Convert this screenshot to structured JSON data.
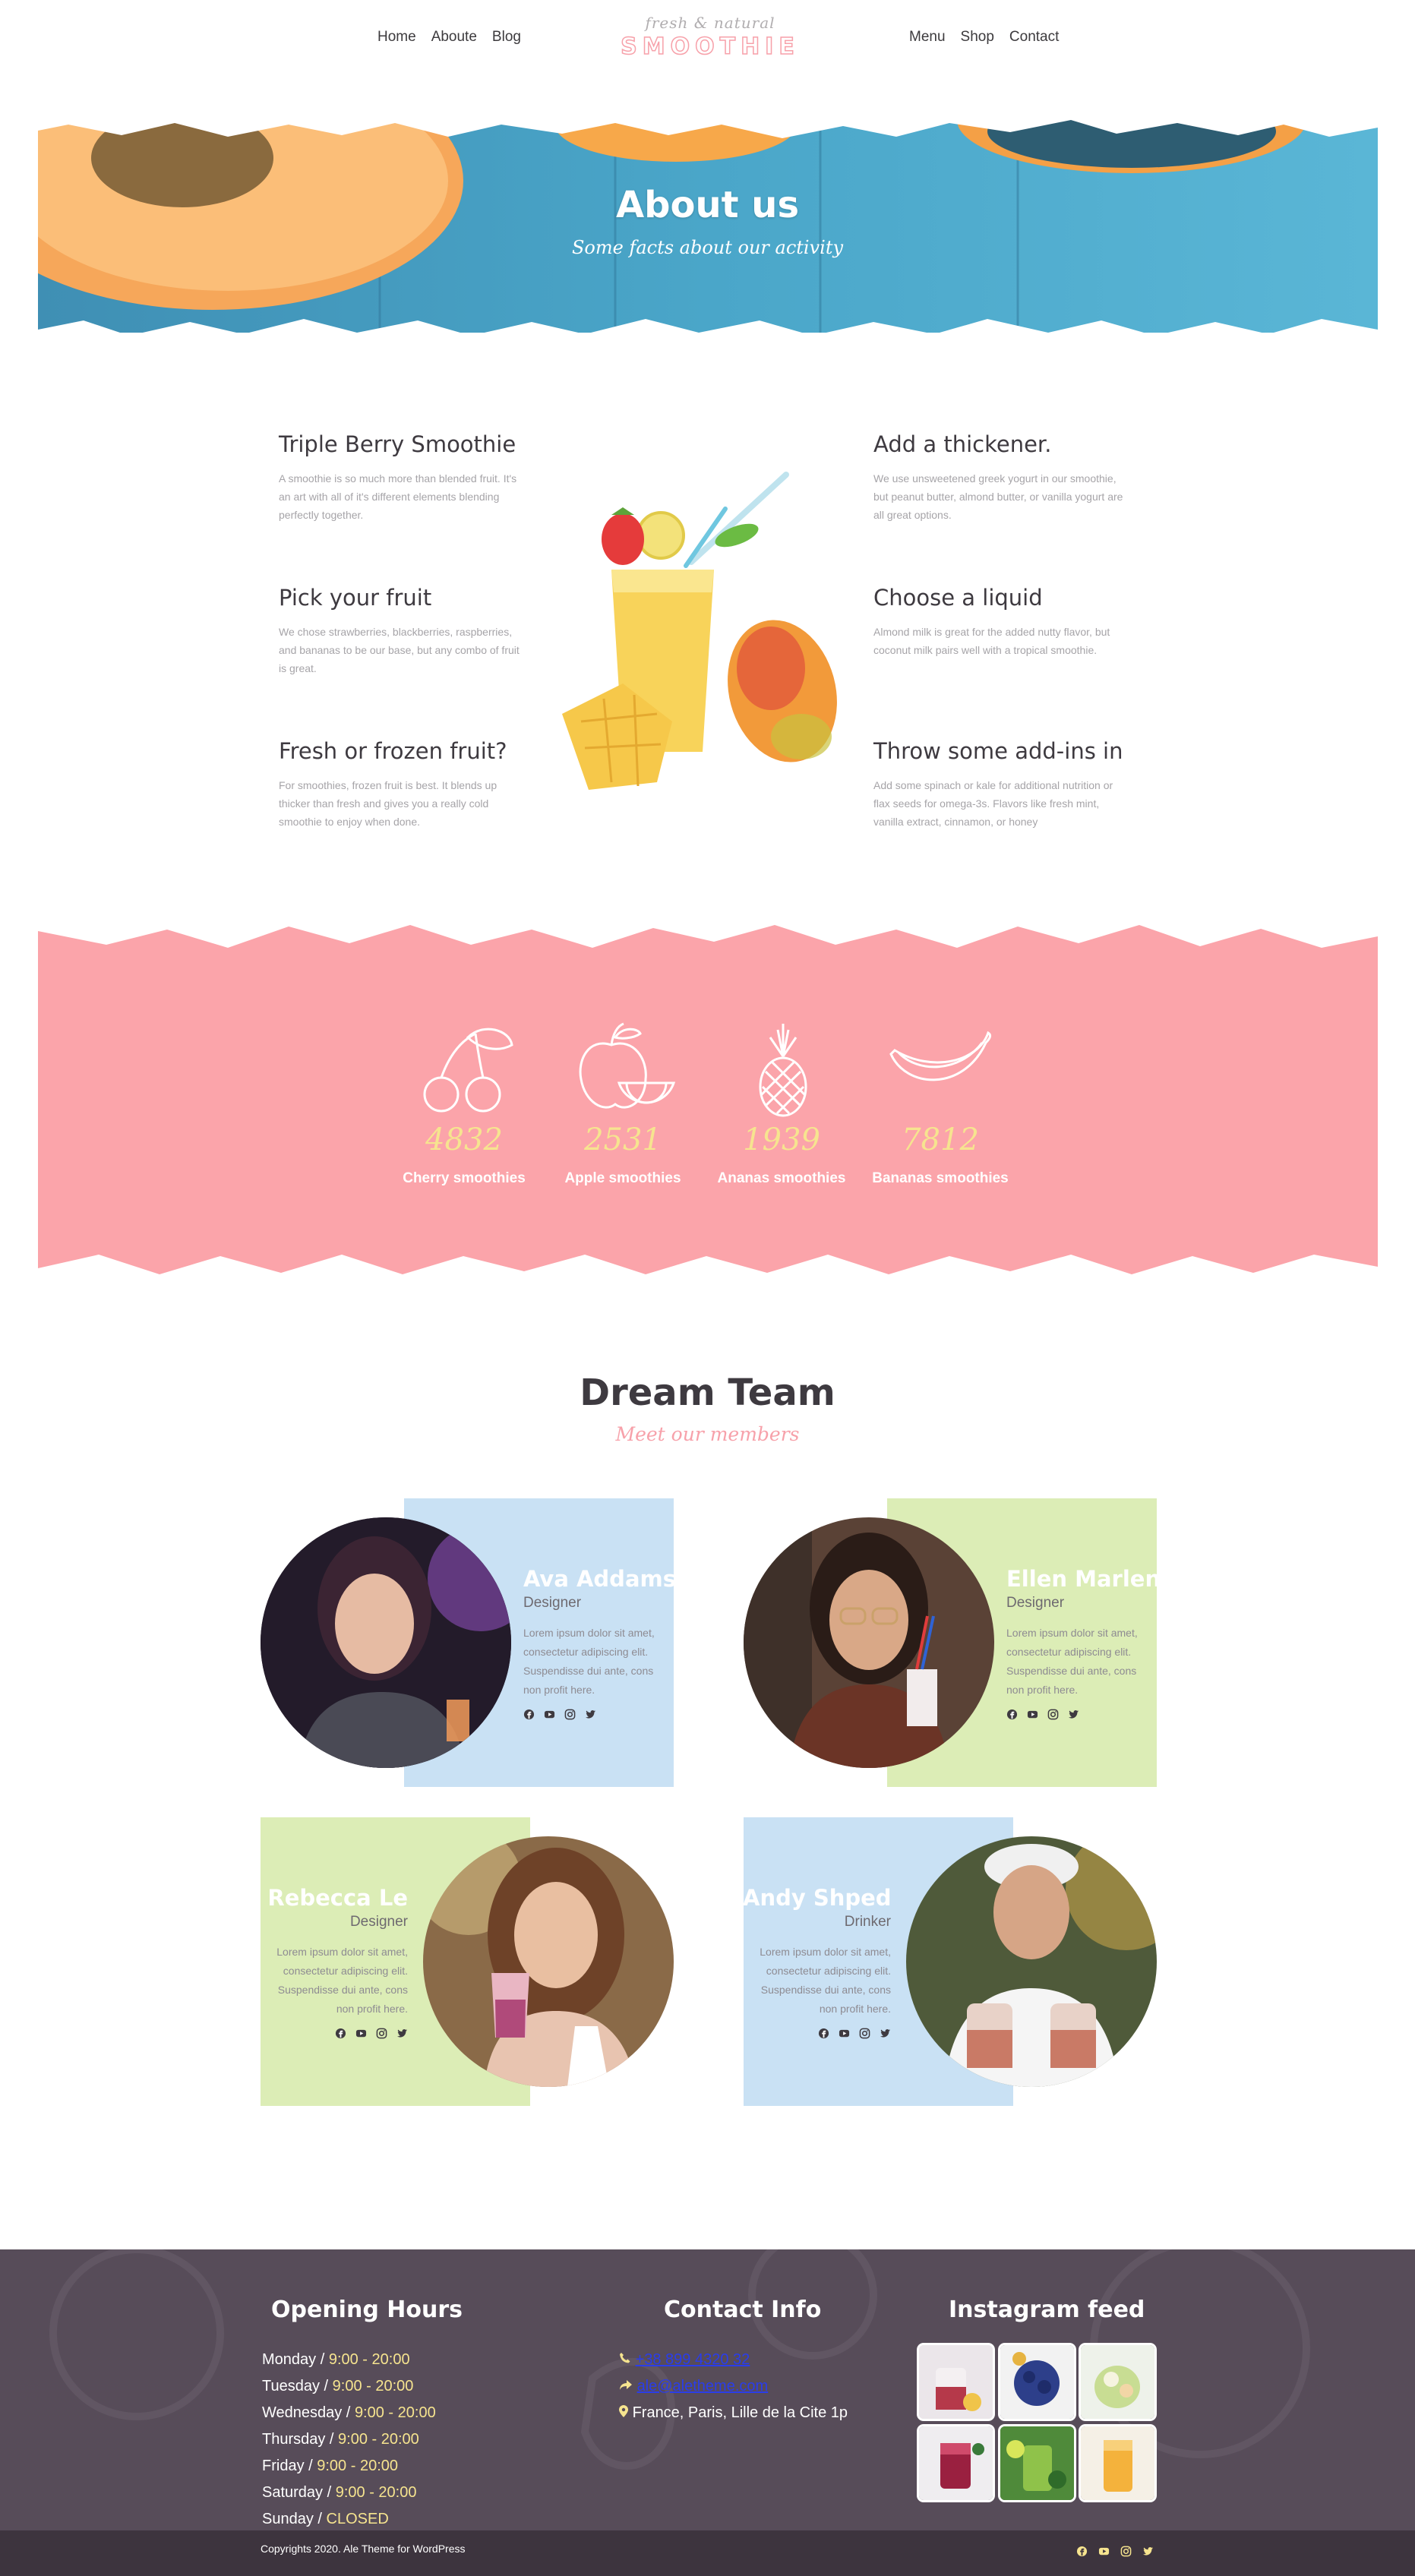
{
  "nav": {
    "left": [
      "Home",
      "Aboute",
      "Blog"
    ],
    "right": [
      "Menu",
      "Shop",
      "Contact"
    ]
  },
  "logo": {
    "tagline": "fresh & natural",
    "name": "SMOOTHIE"
  },
  "hero": {
    "title": "About us",
    "subtitle": "Some facts about our activity"
  },
  "features": {
    "left": [
      {
        "title": "Triple Berry Smoothie",
        "text": "A smoothie is so much more than blended fruit. It's an art with all of it's different elements blending perfectly together."
      },
      {
        "title": "Pick your fruit",
        "text": "We chose strawberries, blackberries, raspberries, and bananas to be our base, but any combo of fruit is great."
      },
      {
        "title": "Fresh or frozen fruit?",
        "text": "For smoothies, frozen fruit is best. It blends up thicker than fresh and gives you a really cold smoothie to enjoy when done."
      }
    ],
    "right": [
      {
        "title": "Add a thickener.",
        "text": "We use unsweetened greek yogurt in our smoothie, but peanut butter, almond butter, or vanilla yogurt are all great options."
      },
      {
        "title": "Choose a liquid",
        "text": "Almond milk is great for the added nutty flavor, but coconut milk pairs well with a tropical smoothie."
      },
      {
        "title": "Throw some add-ins in",
        "text": "Add some spinach or kale for additional nutrition or flax seeds for omega-3s. Flavors like fresh mint, vanilla extract, cinnamon, or honey"
      }
    ]
  },
  "stats": [
    {
      "number": "4832",
      "label": "Cherry smoothies",
      "icon": "cherry-icon"
    },
    {
      "number": "2531",
      "label": "Apple smoothies",
      "icon": "apple-icon"
    },
    {
      "number": "1939",
      "label": "Ananas smoothies",
      "icon": "pineapple-icon"
    },
    {
      "number": "7812",
      "label": "Bananas smoothies",
      "icon": "banana-icon"
    }
  ],
  "team": {
    "title": "Dream Team",
    "subtitle": "Meet our members",
    "members": [
      {
        "name": "Ava Addams",
        "role": "Designer",
        "bio": "Lorem ipsum dolor sit amet, consectetur adipiscing elit. Suspendisse dui ante, cons non profit here."
      },
      {
        "name": "Ellen Marlen",
        "role": "Designer",
        "bio": "Lorem ipsum dolor sit amet, consectetur adipiscing elit. Suspendisse dui ante, cons non profit here."
      },
      {
        "name": "Rebecca Le",
        "role": "Designer",
        "bio": "Lorem ipsum dolor sit amet, consectetur adipiscing elit. Suspendisse dui ante, cons non profit here."
      },
      {
        "name": "Andy Shped",
        "role": "Drinker",
        "bio": "Lorem ipsum dolor sit amet, consectetur adipiscing elit. Suspendisse dui ante, cons non profit here."
      }
    ]
  },
  "footer": {
    "hours_title": "Opening Hours",
    "hours": [
      {
        "day": "Monday / ",
        "time": "9:00 - 20:00"
      },
      {
        "day": "Tuesday / ",
        "time": "9:00 - 20:00"
      },
      {
        "day": "Wednesday / ",
        "time": "9:00 - 20:00"
      },
      {
        "day": "Thursday / ",
        "time": "9:00 - 20:00"
      },
      {
        "day": "Friday / ",
        "time": "9:00 - 20:00"
      },
      {
        "day": "Saturday / ",
        "time": "9:00 - 20:00"
      },
      {
        "day": "Sunday / ",
        "time": "CLOSED"
      }
    ],
    "contact_title": "Contact Info",
    "phone": "+38 899 4320 32",
    "email": "ale@aletheme.com",
    "address": "France, Paris, Lille de la Cite 1p",
    "instagram_title": "Instagram feed",
    "copyright": "Copyrights 2020. Ale Theme for WordPress"
  },
  "colors": {
    "accent_pink": "#f7a1aa",
    "accent_yellow": "#f6e48f",
    "card_blue": "#c9e1f4",
    "card_green": "#dcedb6",
    "footer_bg": "#574c59"
  }
}
